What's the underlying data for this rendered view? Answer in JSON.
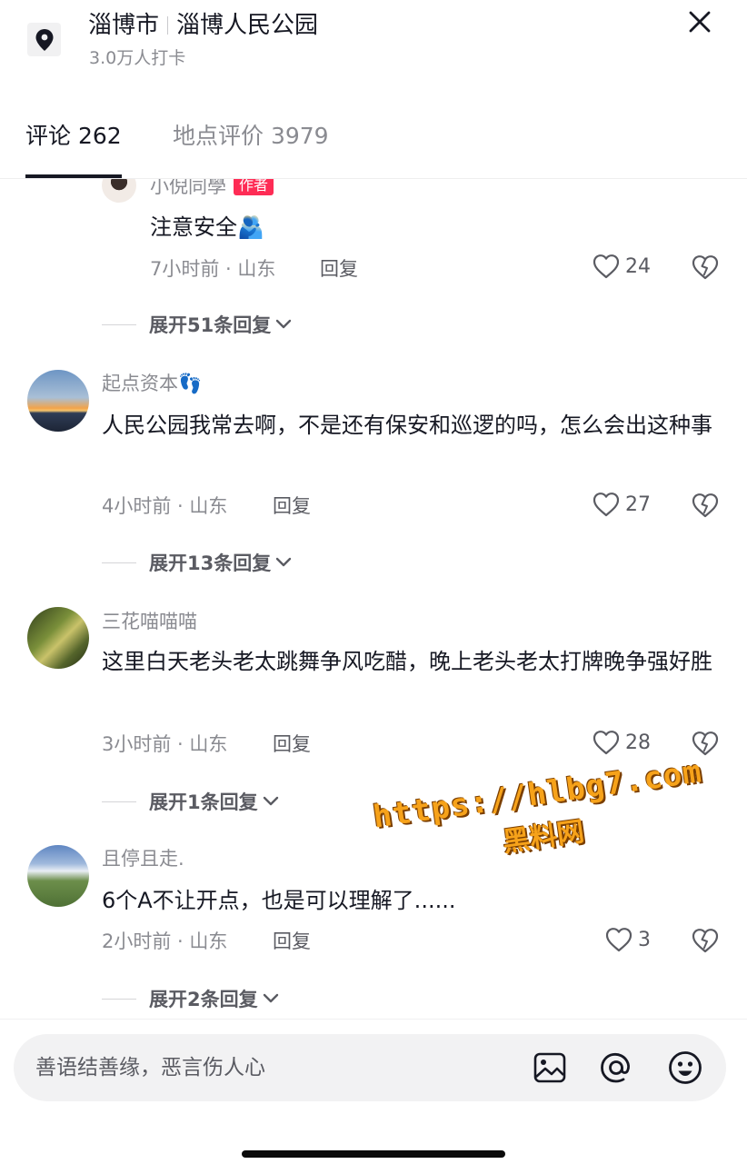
{
  "header": {
    "city": "淄博市",
    "place": "淄博人民公园",
    "checkins": "3.0万人打卡"
  },
  "tabs": [
    {
      "label": "评论 262",
      "active": true
    },
    {
      "label": "地点评价 3979",
      "active": false
    }
  ],
  "comments": [
    {
      "user": "小倪同學",
      "tag": "作者",
      "text": "注意安全🫂",
      "meta": "7小时前 · 山东",
      "reply": "回复",
      "likes": "24",
      "expand": "展开51条回复",
      "nested": true
    },
    {
      "user": "起点资本👣",
      "text": "人民公园我常去啊，不是还有保安和巡逻的吗，怎么会出这种事",
      "meta": "4小时前 · 山东",
      "reply": "回复",
      "likes": "27",
      "expand": "展开13条回复"
    },
    {
      "user": "三花喵喵喵",
      "text": "这里白天老头老太跳舞争风吃醋，晚上老头老太打牌晚争强好胜",
      "meta": "3小时前 · 山东",
      "reply": "回复",
      "likes": "28",
      "expand": "展开1条回复"
    },
    {
      "user": "且停且走.",
      "text": "6个A不让开点，也是可以理解了......",
      "meta": "2小时前 · 山东",
      "reply": "回复",
      "likes": "3",
      "expand": "展开2条回复"
    }
  ],
  "input": {
    "placeholder": "善语结善缘，恶言伤人心"
  },
  "watermark": {
    "line1": "https://hlbg7.com",
    "line2": "黑料网"
  },
  "colors": {
    "accent": "#fe2c55",
    "text": "#161823",
    "secondary": "#8a8b91",
    "watermark": "#f6a21a"
  },
  "icons": [
    "location-pin-icon",
    "close-icon",
    "heart-icon",
    "broken-heart-icon",
    "chevron-down-icon",
    "image-icon",
    "at-icon",
    "emoji-icon"
  ]
}
